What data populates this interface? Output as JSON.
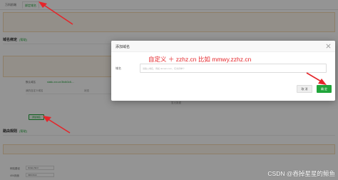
{
  "tabs": [
    "万科前端",
    "绑定域名"
  ],
  "sections": {
    "domain_title": "域名绑定",
    "domain_help": "[帮助]",
    "route_title": "路由规则",
    "route_help": "[帮助]"
  },
  "background_rows": {
    "default_domain_label": "默认域名",
    "default_domain_value": "static-xxx.cn/3bdb3c8-...",
    "custom_domain_label": "我的自定义域名",
    "column_status": "状态",
    "empty_text": "暂无数据",
    "add_label": "添加域名",
    "site_path_label": "网站路径",
    "site_path_value": "/index.html",
    "page404_label": "404页面",
    "page404_value": "/404.html"
  },
  "modal": {
    "title": "添加域名",
    "annotation": "自定义 ＋ zzhz.cn  比如 mmwy.zzhz.cn",
    "field_label": "域名",
    "input_placeholder": "请输入域名，例如 domain.com，仅支持单个",
    "input_value": "",
    "cancel_label": "取 消",
    "confirm_label": "确 定"
  },
  "watermark": "CSDN @吞掉星星的鲸鱼",
  "colors": {
    "accent": "#20a53a",
    "annotation": "#e5252a",
    "mask": "rgba(0,0,0,0.42)"
  },
  "icons": {
    "close": "close-icon",
    "arrow": "red-arrow"
  }
}
